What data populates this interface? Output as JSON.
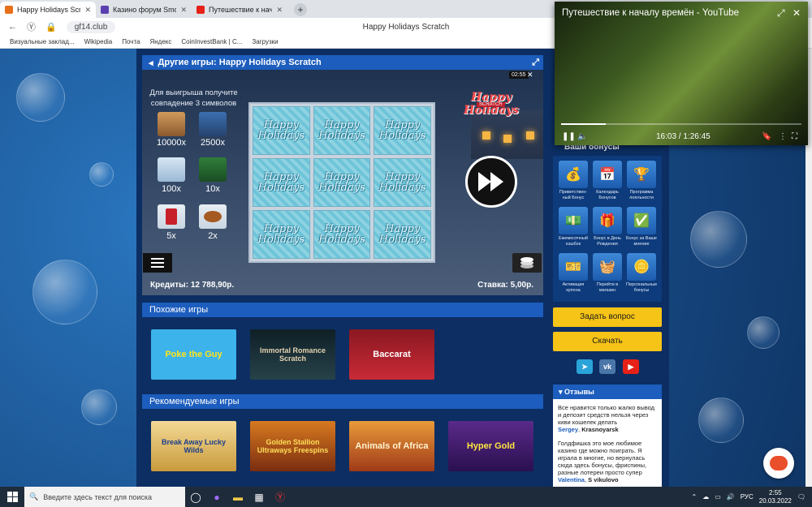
{
  "browser": {
    "tabs": [
      {
        "label": "Happy Holidays Scratch",
        "color": "#e8701a",
        "active": true
      },
      {
        "label": "Казино форум SmoKGame",
        "color": "#5a3fb0",
        "active": false
      },
      {
        "label": "Путешествие к нача...",
        "color": "#e62117",
        "active": false
      }
    ],
    "new_tab": "+",
    "url": "gf14.club",
    "page_title": "Happy Holidays Scratch",
    "bookmarks": [
      "Визуальные заклад...",
      "Wikipedia",
      "Почта",
      "Яндекс",
      "CoinInvestBank | С...",
      "Загрузки"
    ]
  },
  "game": {
    "bar_title": "Другие игры: Happy Holidays Scratch",
    "win_title": "Для выигрыша получите совпадение 3 символов",
    "multipliers": [
      "10000x",
      "2500x",
      "100x",
      "10x",
      "5x",
      "2x"
    ],
    "cell_text": "Happy Holidays",
    "logo": "Happy Holidays",
    "logo_sub": "SCRATCH",
    "timer": "02:55",
    "credits": "Кредиты: 12 788,90р.",
    "stake": "Ставка: 5,00р."
  },
  "similar": {
    "header": "Похожие игры",
    "items": [
      "Poke the Guy",
      "Immortal Romance Scratch",
      "Baccarat"
    ]
  },
  "recommended": {
    "header": "Рекомендуемые игры",
    "items": [
      "Break Away Lucky Wilds",
      "Golden Stallion Ultraways Freespins",
      "Animals of Africa",
      "Hyper Gold"
    ]
  },
  "sidebar": {
    "bonus_header": "Ваши бонусы",
    "bonuses": [
      {
        "label": "Приветствен-ный Бонус",
        "icon": "money-bag-icon"
      },
      {
        "label": "Календарь Бонусов",
        "icon": "calendar-icon"
      },
      {
        "label": "Программа лояльности",
        "icon": "loyalty-icon"
      },
      {
        "label": "Ежемесячный кэшбэк",
        "icon": "cashback-icon"
      },
      {
        "label": "Бонус в День Рождения",
        "icon": "gift-icon"
      },
      {
        "label": "Бонус за Ваше мнение",
        "icon": "checkmark-icon"
      },
      {
        "label": "Активация купона",
        "icon": "coupon-icon"
      },
      {
        "label": "Перейти в магазин",
        "icon": "shop-basket-icon"
      },
      {
        "label": "Персональные бонусы",
        "icon": "personal-bonus-icon"
      }
    ],
    "ask_button": "Задать вопрос",
    "download_button": "Скачать",
    "reviews_header": "Отзывы",
    "reviews": [
      {
        "text": "Все нравится только жалко вывод и депозит средств нельзя через киви кошелек делать",
        "name": "Sergey",
        "city": "Krasnoyarsk"
      },
      {
        "text": "Голдфишка это мое любимое казино где можно поиграть. Я играла в многие, но вернулась сюда здесь бонусы, фриспины, разные лотереи просто супер",
        "name": "Valentina",
        "city": "S vikulovo"
      }
    ]
  },
  "youtube": {
    "title": "Путешествие к началу времён - YouTube",
    "time": "16:03 / 1:26:45",
    "progress": 0.185
  },
  "taskbar": {
    "search_placeholder": "Введите здесь текст для поиска",
    "lang": "РУС",
    "time": "2:55",
    "date": "20.03.2022"
  },
  "colors": {
    "accent": "#1c5dbd",
    "yellow": "#f6c417",
    "panel": "#0c2e63"
  }
}
